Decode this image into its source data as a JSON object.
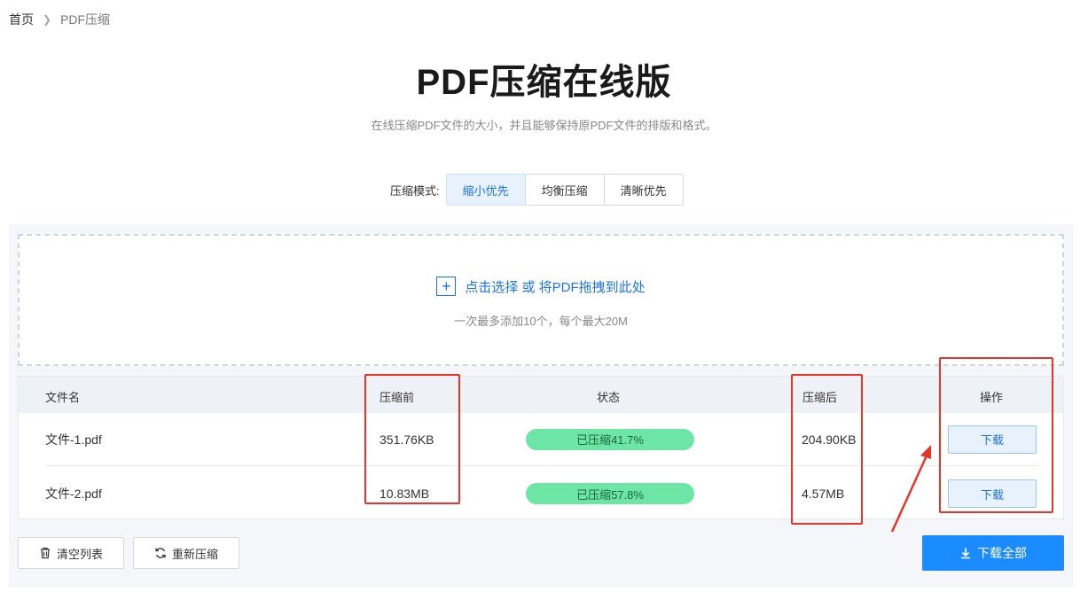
{
  "breadcrumb": {
    "home": "首页",
    "current": "PDF压缩"
  },
  "page": {
    "title": "PDF压缩在线版",
    "subtitle": "在线压缩PDF文件的大小，并且能够保持原PDF文件的排版和格式。"
  },
  "mode": {
    "label": "压缩模式:",
    "options": [
      "缩小优先",
      "均衡压缩",
      "清晰优先"
    ],
    "selected": "缩小优先"
  },
  "upload": {
    "action_text": "点击选择 或 将PDF拖拽到此处",
    "hint": "一次最多添加10个，每个最大20M"
  },
  "table": {
    "headers": [
      "文件名",
      "压缩前",
      "状态",
      "压缩后",
      "操作"
    ],
    "rows": [
      {
        "name": "文件-1.pdf",
        "before": "351.76KB",
        "status": "已压缩41.7%",
        "after": "204.90KB",
        "action": "下载"
      },
      {
        "name": "文件-2.pdf",
        "before": "10.83MB",
        "status": "已压缩57.8%",
        "after": "4.57MB",
        "action": "下载"
      }
    ]
  },
  "footer": {
    "clear_label": "清空列表",
    "recompress_label": "重新压缩",
    "download_all_label": "下载全部"
  },
  "colors": {
    "accent": "#1a73e8",
    "primary_button": "#1a8cff",
    "status_fill": "#6de6a5",
    "highlight": "#e8352a"
  },
  "icons": [
    "chevron-right-icon",
    "plus-icon",
    "trash-icon",
    "refresh-icon",
    "download-icon",
    "arrow-annotation"
  ]
}
